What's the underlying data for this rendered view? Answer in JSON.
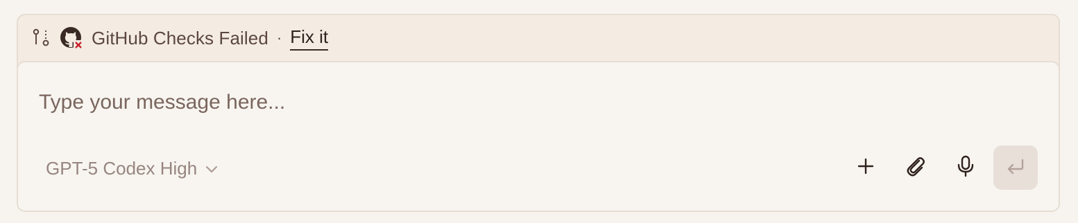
{
  "status_bar": {
    "branch_icon": "git-branch-icon",
    "github_icon": "github-failed-icon",
    "status_text": "GitHub Checks Failed",
    "separator": "·",
    "fix_link": "Fix it"
  },
  "composer": {
    "placeholder": "Type your message here...",
    "model_selector": {
      "selected": "GPT-5 Codex High",
      "icon": "chevron-down-icon"
    },
    "actions": [
      {
        "name": "add",
        "icon": "plus-icon"
      },
      {
        "name": "attach",
        "icon": "paperclip-icon"
      },
      {
        "name": "voice",
        "icon": "microphone-icon"
      },
      {
        "name": "send",
        "icon": "return-enter-icon"
      }
    ]
  },
  "colors": {
    "status_bar_bg": "#f4ece3",
    "card_bg": "#f8f5f0",
    "border": "#e6ddd3",
    "fail_red": "#c8222b",
    "send_bg": "#e7dfd8"
  }
}
